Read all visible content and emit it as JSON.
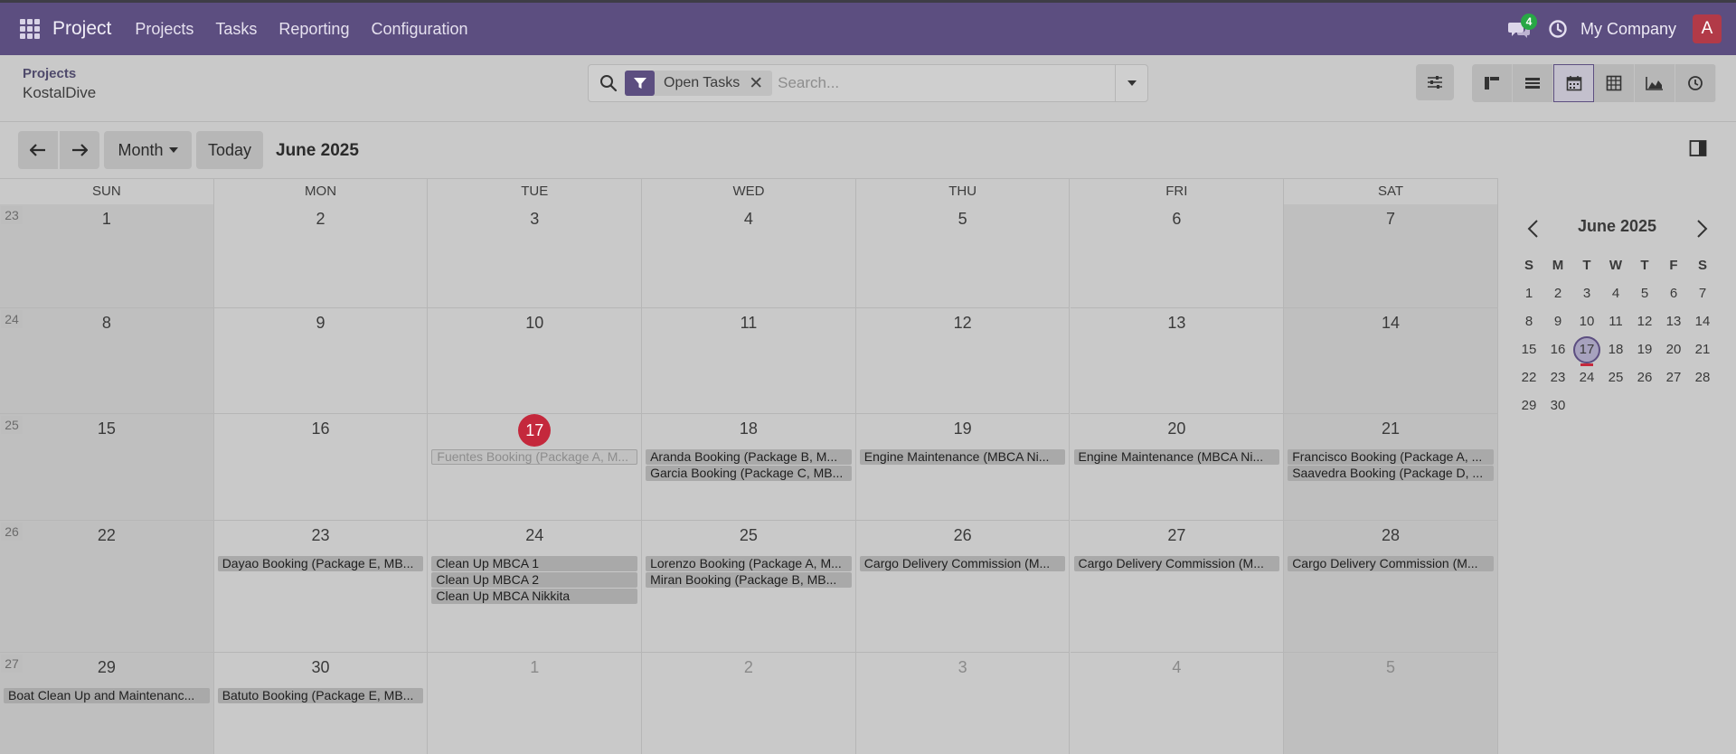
{
  "topbar": {
    "app_name": "Project",
    "menu": [
      "Projects",
      "Tasks",
      "Reporting",
      "Configuration"
    ],
    "chat_count": "4",
    "company": "My Company",
    "avatar_letter": "A"
  },
  "breadcrumb": {
    "parent": "Projects",
    "current": "KostalDive"
  },
  "search": {
    "facet_label": "Open Tasks",
    "placeholder": "Search..."
  },
  "toolbar": {
    "view_mode": "Month",
    "today_label": "Today",
    "period": "June 2025"
  },
  "calendar": {
    "weekdays": [
      "SUN",
      "MON",
      "TUE",
      "WED",
      "THU",
      "FRI",
      "SAT"
    ],
    "weeks": [
      {
        "num": "23",
        "days": [
          "1",
          "2",
          "3",
          "4",
          "5",
          "6",
          "7"
        ]
      },
      {
        "num": "24",
        "days": [
          "8",
          "9",
          "10",
          "11",
          "12",
          "13",
          "14"
        ]
      },
      {
        "num": "25",
        "days": [
          "15",
          "16",
          "17",
          "18",
          "19",
          "20",
          "21"
        ]
      },
      {
        "num": "26",
        "days": [
          "22",
          "23",
          "24",
          "25",
          "26",
          "27",
          "28"
        ]
      },
      {
        "num": "27",
        "days": [
          "29",
          "30",
          "1",
          "2",
          "3",
          "4",
          "5"
        ]
      }
    ],
    "today": "17",
    "events": [
      {
        "week": 2,
        "day": 2,
        "slot": 0,
        "title": "Fuentes Booking (Package A, M...",
        "faded": true
      },
      {
        "week": 2,
        "day": 3,
        "slot": 0,
        "title": "Aranda Booking (Package B, M..."
      },
      {
        "week": 2,
        "day": 3,
        "slot": 1,
        "title": "Garcia Booking (Package C, MB..."
      },
      {
        "week": 2,
        "day": 4,
        "slot": 0,
        "title": "Engine Maintenance (MBCA Ni..."
      },
      {
        "week": 2,
        "day": 5,
        "slot": 0,
        "title": "Engine Maintenance (MBCA Ni..."
      },
      {
        "week": 2,
        "day": 6,
        "slot": 0,
        "title": "Francisco Booking (Package A, ..."
      },
      {
        "week": 2,
        "day": 6,
        "slot": 1,
        "title": "Saavedra Booking (Package D, ..."
      },
      {
        "week": 3,
        "day": 1,
        "slot": 0,
        "title": "Dayao Booking (Package E, MB..."
      },
      {
        "week": 3,
        "day": 2,
        "slot": 0,
        "title": "Clean Up MBCA 1"
      },
      {
        "week": 3,
        "day": 2,
        "slot": 1,
        "title": "Clean Up MBCA 2"
      },
      {
        "week": 3,
        "day": 2,
        "slot": 2,
        "title": "Clean Up MBCA Nikkita"
      },
      {
        "week": 3,
        "day": 3,
        "slot": 0,
        "title": "Lorenzo Booking (Package A, M..."
      },
      {
        "week": 3,
        "day": 3,
        "slot": 1,
        "title": "Miran Booking (Package B, MB..."
      },
      {
        "week": 3,
        "day": 4,
        "slot": 0,
        "title": "Cargo Delivery Commission (M..."
      },
      {
        "week": 3,
        "day": 5,
        "slot": 0,
        "title": "Cargo Delivery Commission (M..."
      },
      {
        "week": 3,
        "day": 6,
        "slot": 0,
        "title": "Cargo Delivery Commission (M..."
      },
      {
        "week": 4,
        "day": 0,
        "slot": 0,
        "title": "Boat Clean Up and Maintenanc..."
      },
      {
        "week": 4,
        "day": 1,
        "slot": 0,
        "title": "Batuto Booking (Package E, MB..."
      }
    ]
  },
  "mini_calendar": {
    "title": "June 2025",
    "weekdays": [
      "S",
      "M",
      "T",
      "W",
      "T",
      "F",
      "S"
    ],
    "rows": [
      [
        "1",
        "2",
        "3",
        "4",
        "5",
        "6",
        "7"
      ],
      [
        "8",
        "9",
        "10",
        "11",
        "12",
        "13",
        "14"
      ],
      [
        "15",
        "16",
        "17",
        "18",
        "19",
        "20",
        "21"
      ],
      [
        "22",
        "23",
        "24",
        "25",
        "26",
        "27",
        "28"
      ],
      [
        "29",
        "30",
        "",
        "",
        "",
        "",
        ""
      ]
    ],
    "today": "17"
  },
  "colors": {
    "brand": "#5c4e80",
    "today": "#c4283c",
    "badge": "#28a745"
  }
}
